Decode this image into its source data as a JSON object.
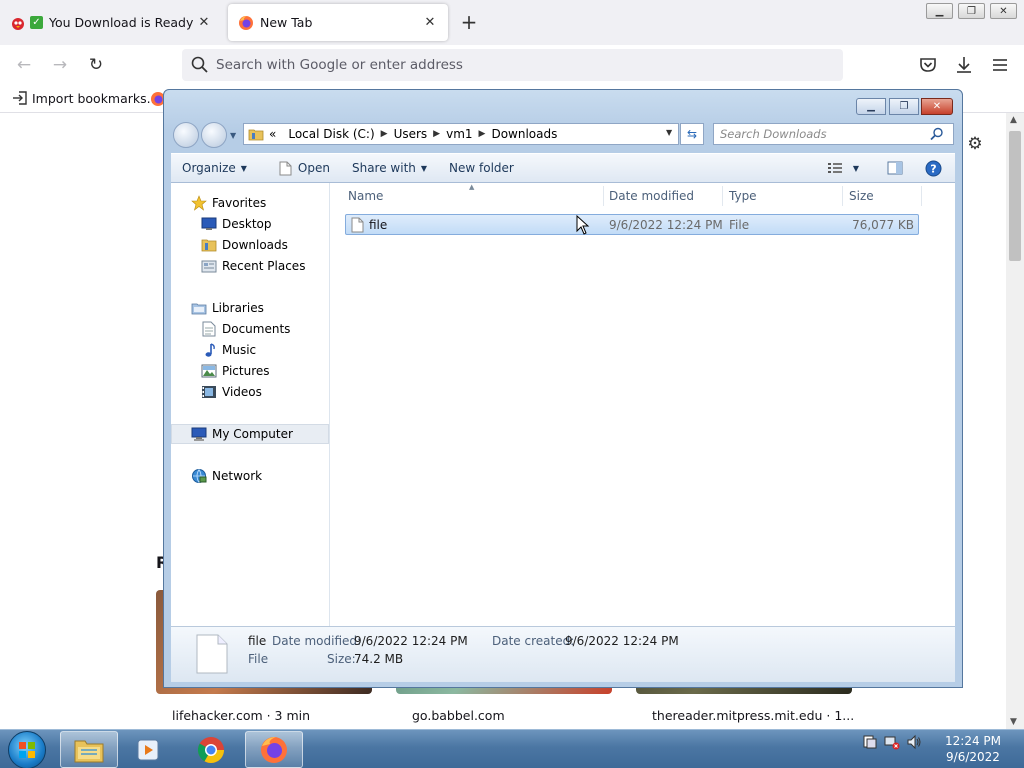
{
  "browser": {
    "tabs": [
      {
        "title": "You Download is Ready",
        "active": false
      },
      {
        "title": "New Tab",
        "active": true
      }
    ],
    "url_placeholder": "Search with Google or enter address",
    "bookmarks": {
      "import_label": "Import bookmarks..."
    }
  },
  "newtab": {
    "section_letter": "R",
    "stories": [
      {
        "source": "lifehacker.com · 3 min"
      },
      {
        "source": "go.babbel.com"
      },
      {
        "source": "thereader.mitpress.mit.edu · 1..."
      }
    ]
  },
  "explorer": {
    "breadcrumb": [
      "Local Disk (C:)",
      "Users",
      "vm1",
      "Downloads"
    ],
    "search_placeholder": "Search Downloads",
    "toolbar": {
      "organize": "Organize",
      "open": "Open",
      "share_with": "Share with",
      "new_folder": "New folder"
    },
    "nav": {
      "favorites": "Favorites",
      "desktop": "Desktop",
      "downloads": "Downloads",
      "recent_places": "Recent Places",
      "libraries": "Libraries",
      "documents": "Documents",
      "music": "Music",
      "pictures": "Pictures",
      "videos": "Videos",
      "my_computer": "My Computer",
      "network": "Network"
    },
    "columns": {
      "name": "Name",
      "date_modified": "Date modified",
      "type": "Type",
      "size": "Size"
    },
    "files": [
      {
        "name": "file",
        "date_modified": "9/6/2022 12:24 PM",
        "type": "File",
        "size": "76,077 KB"
      }
    ],
    "details": {
      "name": "file",
      "type": "File",
      "date_modified_label": "Date modified:",
      "date_modified": "9/6/2022 12:24 PM",
      "size_label": "Size:",
      "size": "74.2 MB",
      "date_created_label": "Date created:",
      "date_created": "9/6/2022 12:24 PM"
    }
  },
  "taskbar": {
    "time": "12:24 PM",
    "date": "9/6/2022"
  },
  "colors": {
    "explorer_frame": "#b6cde6",
    "selection": "#c2dcf7",
    "taskbar": "#4b76a3"
  }
}
